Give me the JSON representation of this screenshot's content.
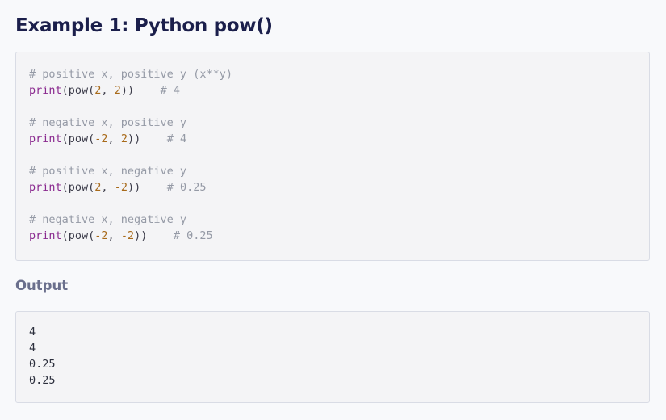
{
  "heading": "Example 1: Python pow()",
  "code": {
    "groups": [
      {
        "comment": "# positive x, positive y (x**y)",
        "func": "print",
        "call_open": "(pow(",
        "arg1": "2",
        "sep": ", ",
        "arg2": "2",
        "call_close": "))    ",
        "result_comment": "# 4"
      },
      {
        "comment": "# negative x, positive y",
        "func": "print",
        "call_open": "(pow(",
        "arg1": "-2",
        "sep": ", ",
        "arg2": "2",
        "call_close": "))    ",
        "result_comment": "# 4"
      },
      {
        "comment": "# positive x, negative y",
        "func": "print",
        "call_open": "(pow(",
        "arg1": "2",
        "sep": ", ",
        "arg2": "-2",
        "call_close": "))    ",
        "result_comment": "# 0.25"
      },
      {
        "comment": "# negative x, negative y",
        "func": "print",
        "call_open": "(pow(",
        "arg1": "-2",
        "sep": ", ",
        "arg2": "-2",
        "call_close": "))    ",
        "result_comment": "# 0.25"
      }
    ]
  },
  "output": {
    "label": "Output",
    "lines": [
      "4",
      "4",
      "0.25",
      "0.25"
    ]
  }
}
